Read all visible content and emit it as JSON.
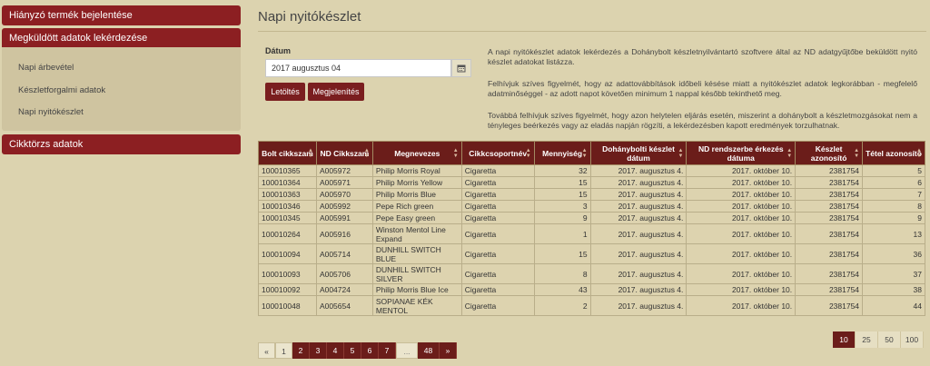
{
  "sidebar": {
    "btn1": "Hiányzó termék bejelentése",
    "btn2": "Megküldött adatok lekérdezése",
    "submenu": [
      "Napi árbevétel",
      "Készletforgalmi adatok",
      "Napi nyitókészlet"
    ],
    "btn3": "Cikktörzs adatok"
  },
  "page": {
    "title": "Napi nyitókészlet",
    "date_label": "Dátum",
    "date_value": "2017 augusztus 04",
    "download": "Letöltés",
    "show": "Megjelenítés"
  },
  "info": [
    "A napi nyitókészlet adatok lekérdezés a Dohánybolt készletnyilvántartó szoftvere által az ND adatgyűjtőbe beküldött nyitó készlet adatokat listázza.",
    "Felhívjuk szíves figyelmét, hogy az adattovábbítások időbeli késése miatt a nyitókészlet adatok legkorábban - megfelelő adatminőséggel - az adott napot követően minimum 1 nappal később tekinthető meg.",
    "Továbbá felhívjuk szíves figyelmét, hogy azon helytelen eljárás esetén, miszerint a dohánybolt a készletmozgásokat nem a tényleges beérkezés vagy az eladás napján rögzíti, a lekérdezésben kapott eredmények torzulhatnak."
  ],
  "table": {
    "headers": [
      "Bolt cikkszam",
      "ND Cikkszam",
      "Megnevezes",
      "Cikkcsoportnév",
      "Mennyiség",
      "Dohánybolti készlet dátum",
      "ND rendszerbe érkezés dátuma",
      "Készlet azonosító",
      "Tétel azonosító"
    ],
    "rows": [
      [
        "100010365",
        "A005972",
        "Philip Morris Royal",
        "Cigaretta",
        "32",
        "2017. augusztus 4.",
        "2017. október 10.",
        "2381754",
        "5"
      ],
      [
        "100010364",
        "A005971",
        "Philip Morris Yellow",
        "Cigaretta",
        "15",
        "2017. augusztus 4.",
        "2017. október 10.",
        "2381754",
        "6"
      ],
      [
        "100010363",
        "A005970",
        "Philip Morris Blue",
        "Cigaretta",
        "15",
        "2017. augusztus 4.",
        "2017. október 10.",
        "2381754",
        "7"
      ],
      [
        "100010346",
        "A005992",
        "Pepe Rich green",
        "Cigaretta",
        "3",
        "2017. augusztus 4.",
        "2017. október 10.",
        "2381754",
        "8"
      ],
      [
        "100010345",
        "A005991",
        "Pepe Easy green",
        "Cigaretta",
        "9",
        "2017. augusztus 4.",
        "2017. október 10.",
        "2381754",
        "9"
      ],
      [
        "100010264",
        "A005916",
        "Winston Mentol Line Expand",
        "Cigaretta",
        "1",
        "2017. augusztus 4.",
        "2017. október 10.",
        "2381754",
        "13"
      ],
      [
        "100010094",
        "A005714",
        "DUNHILL SWITCH BLUE",
        "Cigaretta",
        "15",
        "2017. augusztus 4.",
        "2017. október 10.",
        "2381754",
        "36"
      ],
      [
        "100010093",
        "A005706",
        "DUNHILL SWITCH SILVER",
        "Cigaretta",
        "8",
        "2017. augusztus 4.",
        "2017. október 10.",
        "2381754",
        "37"
      ],
      [
        "100010092",
        "A004724",
        "Philip Morris Blue Ice",
        "Cigaretta",
        "43",
        "2017. augusztus 4.",
        "2017. október 10.",
        "2381754",
        "38"
      ],
      [
        "100010048",
        "A005654",
        "SOPIANAE KÉK MENTOL",
        "Cigaretta",
        "2",
        "2017. augusztus 4.",
        "2017. október 10.",
        "2381754",
        "44"
      ]
    ]
  },
  "pagination": [
    "«",
    "1",
    "2",
    "3",
    "4",
    "5",
    "6",
    "7",
    "...",
    "48",
    "»"
  ],
  "page_sizes": [
    "10",
    "25",
    "50",
    "100"
  ]
}
